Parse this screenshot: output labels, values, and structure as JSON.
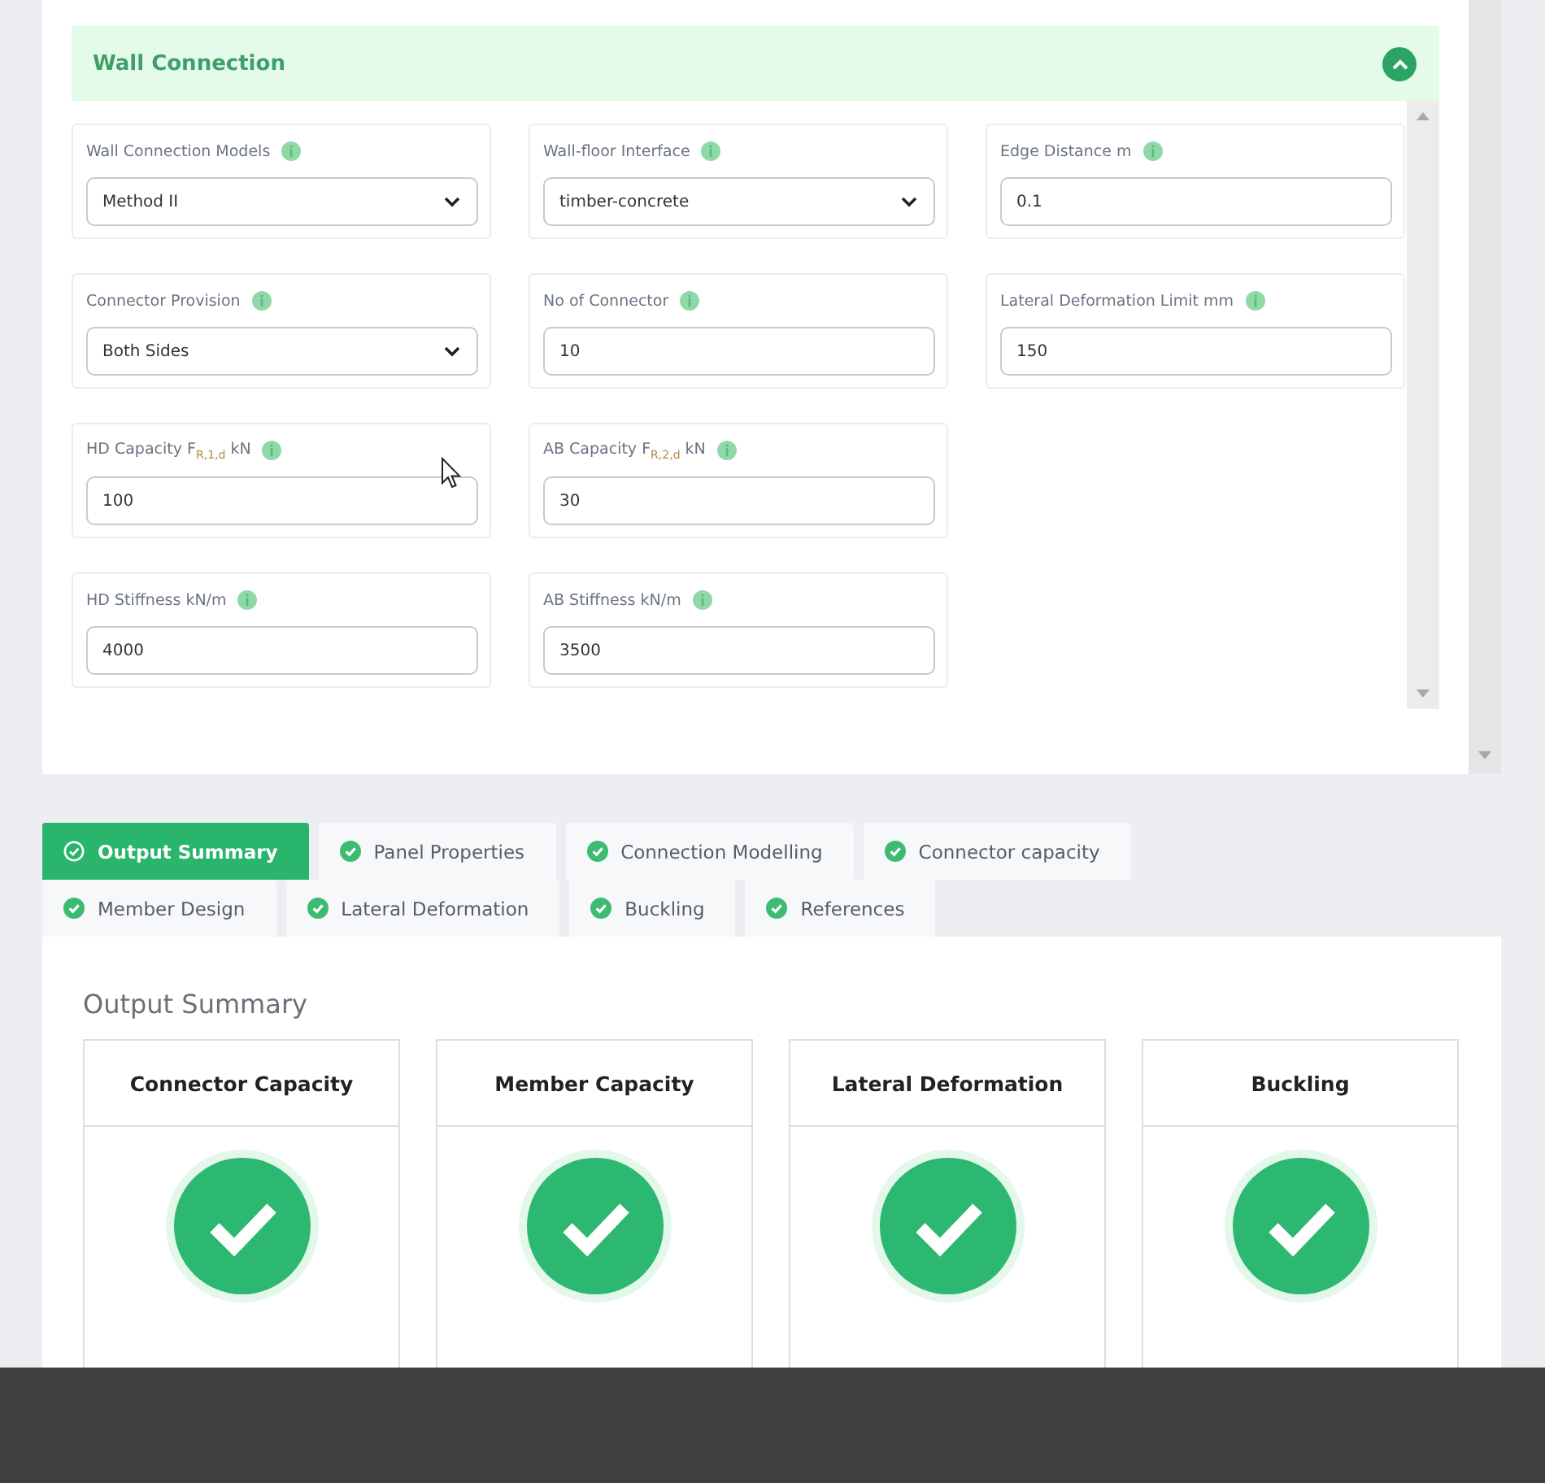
{
  "section": {
    "title": "Wall Connection",
    "expanded": true,
    "rows": [
      [
        {
          "label": "Wall Connection Models",
          "kind": "select",
          "value": "Method II"
        },
        {
          "label": "Wall-floor Interface",
          "kind": "select",
          "value": "timber-concrete"
        },
        {
          "label": "Edge Distance m",
          "kind": "text",
          "value": "0.1"
        }
      ],
      [
        {
          "label": "Connector Provision",
          "kind": "select",
          "value": "Both Sides"
        },
        {
          "label": "No of Connector",
          "kind": "text",
          "value": "10"
        },
        {
          "label": "Lateral Deformation Limit mm",
          "kind": "text",
          "value": "150"
        }
      ],
      [
        {
          "label": "HD Capacity F$_{R,1,d}$ kN",
          "kind": "text",
          "value": "100"
        },
        {
          "label": "AB Capacity F$_{R,2,d}$ kN",
          "kind": "text",
          "value": "30"
        }
      ],
      [
        {
          "label": "HD Stiffness kN/m",
          "kind": "text",
          "value": "4000"
        },
        {
          "label": "AB Stiffness kN/m",
          "kind": "text",
          "value": "3500"
        }
      ]
    ]
  },
  "tabs": [
    {
      "label": "Output Summary",
      "selected": true
    },
    {
      "label": "Panel Properties",
      "selected": false
    },
    {
      "label": "Connection Modelling",
      "selected": false
    },
    {
      "label": "Connector capacity",
      "selected": false
    },
    {
      "label": "Member Design",
      "selected": false
    },
    {
      "label": "Lateral Deformation",
      "selected": false
    },
    {
      "label": "Buckling",
      "selected": false
    },
    {
      "label": "References",
      "selected": false
    }
  ],
  "summary": {
    "title": "Output Summary",
    "cards": [
      {
        "title": "Connector Capacity",
        "passed": true
      },
      {
        "title": "Member Capacity",
        "passed": true
      },
      {
        "title": "Lateral Deformation",
        "passed": true
      },
      {
        "title": "Buckling",
        "passed": true
      }
    ]
  }
}
